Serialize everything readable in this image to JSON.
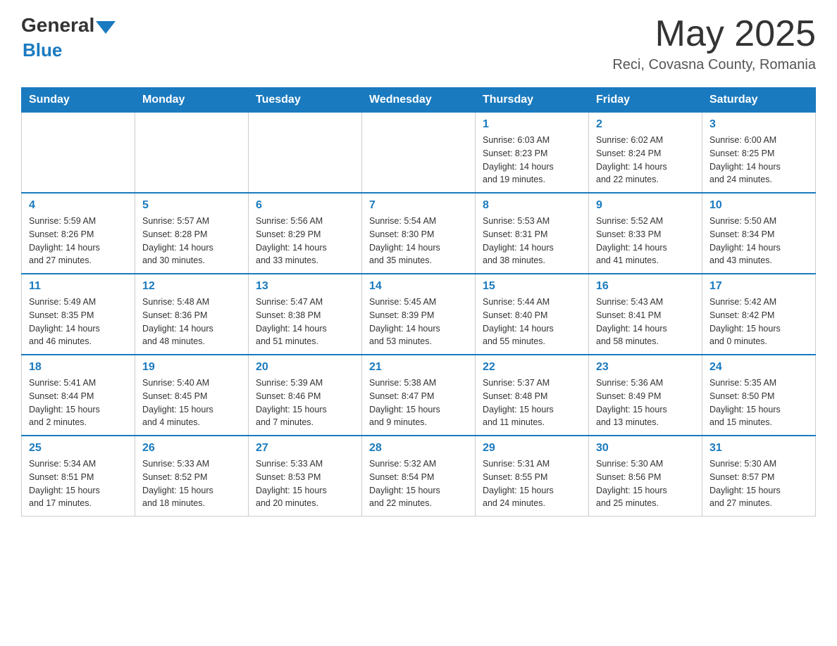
{
  "logo": {
    "general": "General",
    "blue": "Blue"
  },
  "title": "May 2025",
  "location": "Reci, Covasna County, Romania",
  "days_of_week": [
    "Sunday",
    "Monday",
    "Tuesday",
    "Wednesday",
    "Thursday",
    "Friday",
    "Saturday"
  ],
  "weeks": [
    [
      {
        "day": "",
        "info": ""
      },
      {
        "day": "",
        "info": ""
      },
      {
        "day": "",
        "info": ""
      },
      {
        "day": "",
        "info": ""
      },
      {
        "day": "1",
        "info": "Sunrise: 6:03 AM\nSunset: 8:23 PM\nDaylight: 14 hours\nand 19 minutes."
      },
      {
        "day": "2",
        "info": "Sunrise: 6:02 AM\nSunset: 8:24 PM\nDaylight: 14 hours\nand 22 minutes."
      },
      {
        "day": "3",
        "info": "Sunrise: 6:00 AM\nSunset: 8:25 PM\nDaylight: 14 hours\nand 24 minutes."
      }
    ],
    [
      {
        "day": "4",
        "info": "Sunrise: 5:59 AM\nSunset: 8:26 PM\nDaylight: 14 hours\nand 27 minutes."
      },
      {
        "day": "5",
        "info": "Sunrise: 5:57 AM\nSunset: 8:28 PM\nDaylight: 14 hours\nand 30 minutes."
      },
      {
        "day": "6",
        "info": "Sunrise: 5:56 AM\nSunset: 8:29 PM\nDaylight: 14 hours\nand 33 minutes."
      },
      {
        "day": "7",
        "info": "Sunrise: 5:54 AM\nSunset: 8:30 PM\nDaylight: 14 hours\nand 35 minutes."
      },
      {
        "day": "8",
        "info": "Sunrise: 5:53 AM\nSunset: 8:31 PM\nDaylight: 14 hours\nand 38 minutes."
      },
      {
        "day": "9",
        "info": "Sunrise: 5:52 AM\nSunset: 8:33 PM\nDaylight: 14 hours\nand 41 minutes."
      },
      {
        "day": "10",
        "info": "Sunrise: 5:50 AM\nSunset: 8:34 PM\nDaylight: 14 hours\nand 43 minutes."
      }
    ],
    [
      {
        "day": "11",
        "info": "Sunrise: 5:49 AM\nSunset: 8:35 PM\nDaylight: 14 hours\nand 46 minutes."
      },
      {
        "day": "12",
        "info": "Sunrise: 5:48 AM\nSunset: 8:36 PM\nDaylight: 14 hours\nand 48 minutes."
      },
      {
        "day": "13",
        "info": "Sunrise: 5:47 AM\nSunset: 8:38 PM\nDaylight: 14 hours\nand 51 minutes."
      },
      {
        "day": "14",
        "info": "Sunrise: 5:45 AM\nSunset: 8:39 PM\nDaylight: 14 hours\nand 53 minutes."
      },
      {
        "day": "15",
        "info": "Sunrise: 5:44 AM\nSunset: 8:40 PM\nDaylight: 14 hours\nand 55 minutes."
      },
      {
        "day": "16",
        "info": "Sunrise: 5:43 AM\nSunset: 8:41 PM\nDaylight: 14 hours\nand 58 minutes."
      },
      {
        "day": "17",
        "info": "Sunrise: 5:42 AM\nSunset: 8:42 PM\nDaylight: 15 hours\nand 0 minutes."
      }
    ],
    [
      {
        "day": "18",
        "info": "Sunrise: 5:41 AM\nSunset: 8:44 PM\nDaylight: 15 hours\nand 2 minutes."
      },
      {
        "day": "19",
        "info": "Sunrise: 5:40 AM\nSunset: 8:45 PM\nDaylight: 15 hours\nand 4 minutes."
      },
      {
        "day": "20",
        "info": "Sunrise: 5:39 AM\nSunset: 8:46 PM\nDaylight: 15 hours\nand 7 minutes."
      },
      {
        "day": "21",
        "info": "Sunrise: 5:38 AM\nSunset: 8:47 PM\nDaylight: 15 hours\nand 9 minutes."
      },
      {
        "day": "22",
        "info": "Sunrise: 5:37 AM\nSunset: 8:48 PM\nDaylight: 15 hours\nand 11 minutes."
      },
      {
        "day": "23",
        "info": "Sunrise: 5:36 AM\nSunset: 8:49 PM\nDaylight: 15 hours\nand 13 minutes."
      },
      {
        "day": "24",
        "info": "Sunrise: 5:35 AM\nSunset: 8:50 PM\nDaylight: 15 hours\nand 15 minutes."
      }
    ],
    [
      {
        "day": "25",
        "info": "Sunrise: 5:34 AM\nSunset: 8:51 PM\nDaylight: 15 hours\nand 17 minutes."
      },
      {
        "day": "26",
        "info": "Sunrise: 5:33 AM\nSunset: 8:52 PM\nDaylight: 15 hours\nand 18 minutes."
      },
      {
        "day": "27",
        "info": "Sunrise: 5:33 AM\nSunset: 8:53 PM\nDaylight: 15 hours\nand 20 minutes."
      },
      {
        "day": "28",
        "info": "Sunrise: 5:32 AM\nSunset: 8:54 PM\nDaylight: 15 hours\nand 22 minutes."
      },
      {
        "day": "29",
        "info": "Sunrise: 5:31 AM\nSunset: 8:55 PM\nDaylight: 15 hours\nand 24 minutes."
      },
      {
        "day": "30",
        "info": "Sunrise: 5:30 AM\nSunset: 8:56 PM\nDaylight: 15 hours\nand 25 minutes."
      },
      {
        "day": "31",
        "info": "Sunrise: 5:30 AM\nSunset: 8:57 PM\nDaylight: 15 hours\nand 27 minutes."
      }
    ]
  ]
}
